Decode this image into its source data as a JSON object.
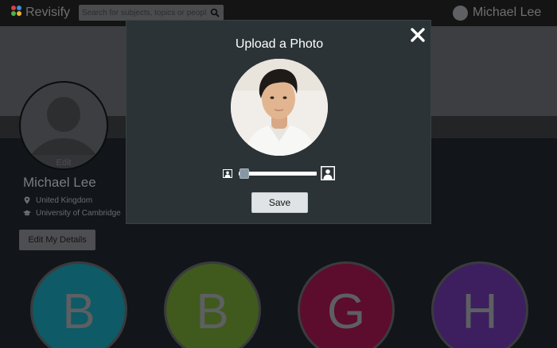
{
  "app": {
    "name": "Revisify",
    "logo_colors": [
      "#d9413f",
      "#3f8fd4",
      "#4db24c",
      "#e5b72e"
    ]
  },
  "search": {
    "placeholder": "Search for subjects, topics or people",
    "icon": "search-icon"
  },
  "user": {
    "name": "Michael Lee"
  },
  "profile": {
    "avatar_edit_label": "Edit",
    "name": "Michael Lee",
    "location": "United Kingdom",
    "location_icon": "location-pin-icon",
    "university": "University of Cambridge",
    "university_icon": "graduation-cap-icon",
    "edit_button": "Edit My Details"
  },
  "subjects": [
    {
      "letter": "B",
      "color": "#0e5a66"
    },
    {
      "letter": "B",
      "color": "#3f5a1c"
    },
    {
      "letter": "G",
      "color": "#5c0c2c"
    },
    {
      "letter": "H",
      "color": "#3d1f5f"
    }
  ],
  "modal": {
    "title": "Upload a Photo",
    "close_icon": "close-icon",
    "zoom_min_icon": "small-image-icon",
    "zoom_max_icon": "large-image-icon",
    "zoom_level": 0.07,
    "save_label": "Save"
  }
}
